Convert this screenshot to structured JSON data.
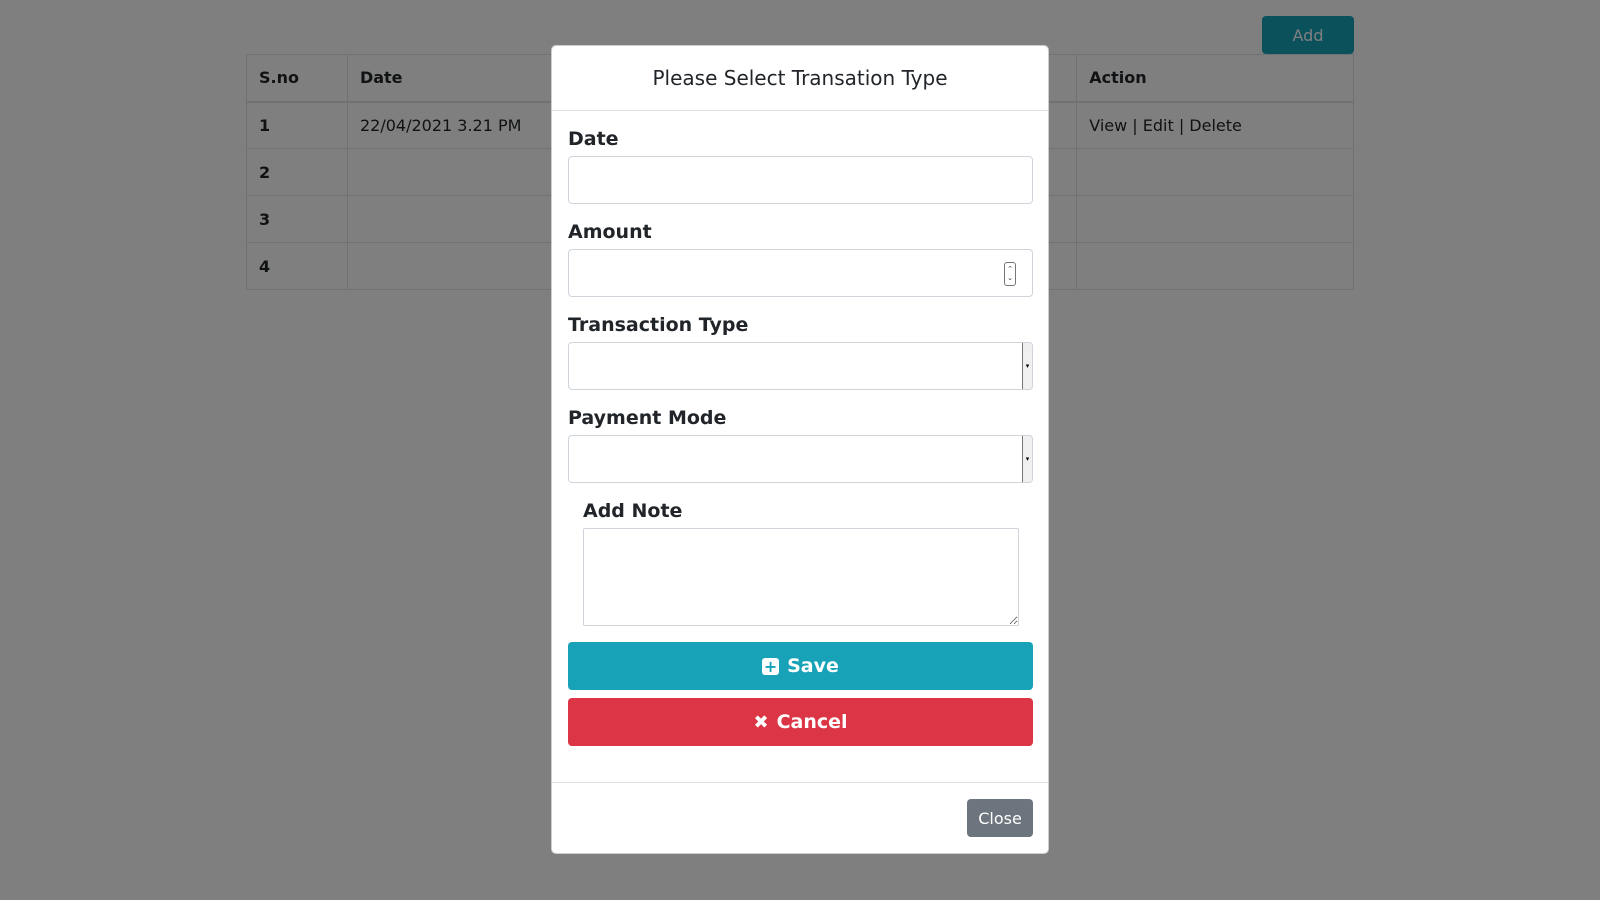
{
  "page": {
    "add_label": "Add",
    "table": {
      "headers": [
        "S.no",
        "Date",
        "",
        "Action"
      ],
      "rows": [
        {
          "sno": "1",
          "date": "22/04/2021 3.21 PM",
          "col3": "",
          "action": "View | Edit | Delete"
        },
        {
          "sno": "2",
          "date": "",
          "col3": "",
          "action": ""
        },
        {
          "sno": "3",
          "date": "",
          "col3": "",
          "action": ""
        },
        {
          "sno": "4",
          "date": "",
          "col3": "",
          "action": ""
        }
      ]
    }
  },
  "modal": {
    "title": "Please Select Transation Type",
    "fields": {
      "date_label": "Date",
      "amount_label": "Amount",
      "transaction_type_label": "Transaction Type",
      "payment_mode_label": "Payment Mode",
      "note_label": "Add Note"
    },
    "values": {
      "date": "",
      "amount": "",
      "transaction_type": "",
      "payment_mode": "",
      "note": ""
    },
    "save_label": "Save",
    "cancel_label": "Cancel",
    "close_label": "Close"
  },
  "colors": {
    "info": "#17a2b8",
    "danger": "#dc3545",
    "secondary": "#6c757d",
    "backdrop": "rgba(0,0,0,0.5)"
  },
  "icons": {
    "save": "plus-square-icon",
    "cancel": "times-icon",
    "spinner": "spinner-arrows-icon",
    "select": "caret-down-icon"
  }
}
